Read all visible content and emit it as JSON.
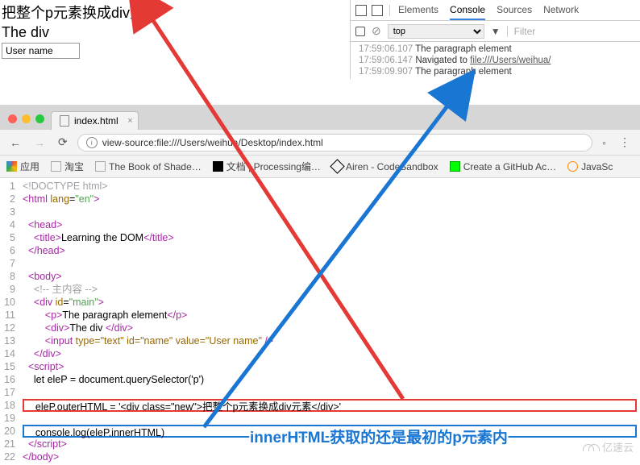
{
  "pageSample": {
    "heading": "把整个p元素换成div元素",
    "divText": "The div",
    "inputValue": "User name"
  },
  "devtools": {
    "tabs": {
      "elements": "Elements",
      "console": "Console",
      "sources": "Sources",
      "network": "Network"
    },
    "activeTab": "Console",
    "execContext": "top",
    "filterPlaceholder": "Filter",
    "log": [
      {
        "ts": "17:59:06.107",
        "msg": "The paragraph element"
      },
      {
        "ts": "17:59:06.147",
        "msg": "Navigated to ",
        "link": "file:///Users/weihua/"
      },
      {
        "ts": "17:59:09.907",
        "msg": "The paragraph element"
      }
    ]
  },
  "browser": {
    "tabTitle": "index.html",
    "url": "view-source:file:///Users/weihua/Desktop/index.html",
    "bookmarks": {
      "apps": "应用",
      "taobao": "淘宝",
      "book": "The Book of Shade…",
      "wen": "文档 | Processing编…",
      "airen": "Airen - CodeSandbox",
      "github": "Create a GitHub Ac…",
      "js": "JavaSc"
    }
  },
  "source": {
    "l1": "<!DOCTYPE html>",
    "l2": {
      "t1": "<html ",
      "a": "lang",
      "eq": "=",
      "v": "\"en\"",
      "t2": ">"
    },
    "l4": "<head>",
    "l5": {
      "o": "    <title>",
      "txt": "Learning the DOM",
      "c": "</title>"
    },
    "l6": "</head>",
    "l8": "<body>",
    "l9": "    <!-- 主内容 -->",
    "l10": {
      "o": "    <div ",
      "a": "id",
      "v": "\"main\"",
      "c": ">"
    },
    "l11": {
      "o": "        <p>",
      "txt": "The paragraph element",
      "c": "</p>"
    },
    "l12": {
      "o": "        <div>",
      "txt": "The div ",
      "c": "</div>"
    },
    "l13": {
      "o": "        <input ",
      "pairs": "type=\"text\" id=\"name\" value=\"User name\"",
      "c": " />"
    },
    "l14": "    </div>",
    "l15": "<script>",
    "l16": "    let eleP = document.querySelector('p')",
    "l18": "    eleP.outerHTML = '<div class=\"new\">把整个p元素换成div元素</div>'",
    "l20": "    console.log(eleP.innerHTML)",
    "l21": "</script>",
    "l22": "</body>"
  },
  "annotation": "innerHTML获取的还是最初的p元素内",
  "watermark": "亿速云"
}
